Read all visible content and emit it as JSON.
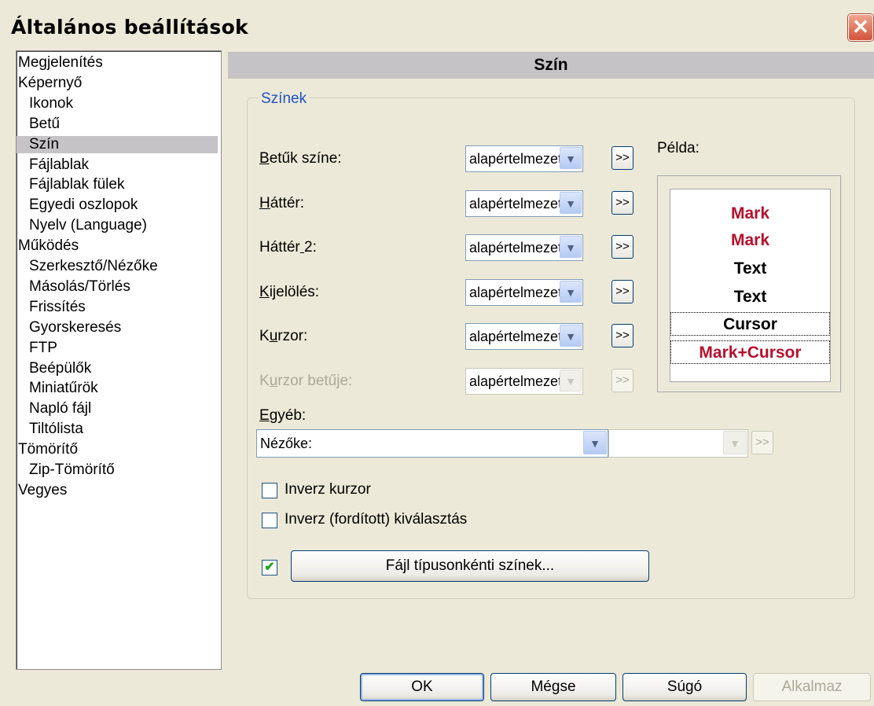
{
  "window": {
    "title": "Általános beállítások",
    "close_icon": "close-icon"
  },
  "tree": {
    "items": [
      {
        "label": "Megjelenítés",
        "level": 0
      },
      {
        "label": "Képernyő",
        "level": 0
      },
      {
        "label": "Ikonok",
        "level": 1
      },
      {
        "label": "Betű",
        "level": 1
      },
      {
        "label": "Szín",
        "level": 1,
        "selected": true
      },
      {
        "label": "Fájlablak",
        "level": 1
      },
      {
        "label": "Fájlablak fülek",
        "level": 1
      },
      {
        "label": "Egyedi oszlopok",
        "level": 1
      },
      {
        "label": "Nyelv (Language)",
        "level": 1
      },
      {
        "label": "Működés",
        "level": 0
      },
      {
        "label": "Szerkesztő/Nézőke",
        "level": 1
      },
      {
        "label": "Másolás/Törlés",
        "level": 1
      },
      {
        "label": "Frissítés",
        "level": 1
      },
      {
        "label": "Gyorskeresés",
        "level": 1
      },
      {
        "label": "FTP",
        "level": 1
      },
      {
        "label": "Beépülők",
        "level": 1
      },
      {
        "label": "Miniatűrök",
        "level": 1
      },
      {
        "label": "Napló fájl",
        "level": 1
      },
      {
        "label": "Tiltólista",
        "level": 1
      },
      {
        "label": "Tömörítő",
        "level": 0
      },
      {
        "label": "Zip-Tömörítő",
        "level": 1
      },
      {
        "label": "Vegyes",
        "level": 0
      }
    ]
  },
  "panel": {
    "header": "Szín",
    "group_title": "Színek",
    "example_label": "Példa:",
    "rows": [
      {
        "label": "Betűk színe:",
        "value": "alapértelmezet",
        "enabled": true
      },
      {
        "label": "Háttér:",
        "value": "alapértelmezet",
        "enabled": true
      },
      {
        "label": "Háttér 2:",
        "value": "alapértelmezet",
        "enabled": true
      },
      {
        "label": "Kijelölés:",
        "value": "alapértelmezet",
        "enabled": true
      },
      {
        "label": "Kurzor:",
        "value": "alapértelmezet",
        "enabled": true
      },
      {
        "label": "Kurzor betűje:",
        "value": "alapértelmezet",
        "enabled": false
      }
    ],
    "more_label": ">>",
    "other_label": "Egyéb:",
    "other_select_value": "Nézőke:",
    "other_color_value": "",
    "preview": [
      {
        "text": "Mark",
        "style": "mark"
      },
      {
        "text": "Mark",
        "style": "mark"
      },
      {
        "text": "Text",
        "style": "text"
      },
      {
        "text": "Text",
        "style": "text"
      },
      {
        "text": "Cursor",
        "style": "cursor"
      },
      {
        "text": "Mark+Cursor",
        "style": "mark-cursor"
      }
    ],
    "inverse_cursor": {
      "label": "Inverz kurzor",
      "checked": false
    },
    "inverse_selection": {
      "label": "Inverz (fordított) kiválasztás",
      "checked": false
    },
    "filetype_colors": {
      "label": "Fájl típusonkénti színek...",
      "checked": true
    }
  },
  "buttons": {
    "ok": "OK",
    "cancel": "Mégse",
    "help": "Súgó",
    "apply": "Alkalmaz"
  },
  "colors": {
    "accent": "#2151c2",
    "mark": "#b5102d",
    "selection": "#c6c3c6"
  }
}
